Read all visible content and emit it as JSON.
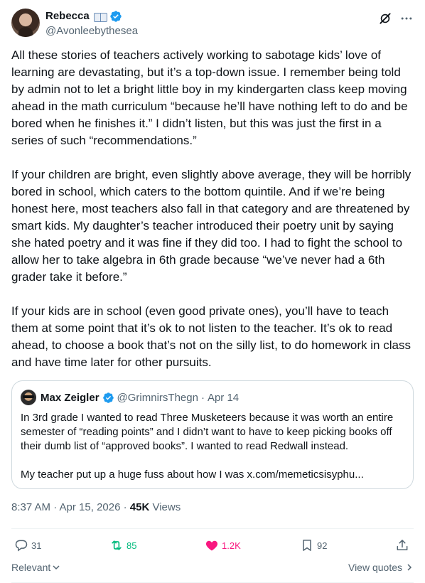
{
  "author": {
    "display_name": "Rebecca",
    "emoji_icon": "open-book-icon",
    "handle": "@Avonleebythesea"
  },
  "tweet": {
    "paragraphs": [
      "All these stories of teachers actively working to sabotage kids’ love of learning are devastating, but it’s a top-down issue. I remember being told by admin not to let a bright little boy in my kindergarten class keep moving ahead in the math curriculum “because he’ll have nothing left to do and be bored when he finishes it.” I didn’t listen, but this was just the first in a series of such “recommendations.”",
      "If your children are bright, even slightly above average, they will be horribly bored in school, which caters to the bottom quintile. And if we’re being honest here, most teachers also fall in that category and are threatened by smart kids. My daughter’s teacher introduced their poetry unit by saying she hated poetry and it was fine if they did too. I had to fight the school to allow her to take algebra in 6th grade because “we’ve never had a 6th grader take it before.”",
      "If your kids are in school (even good private ones), you’ll have to teach them at some point that it’s ok to not listen to the teacher. It’s ok to read ahead, to choose a book that’s not on the silly list, to do homework in class and have time later for other pursuits."
    ]
  },
  "quote": {
    "display_name": "Max Zeigler",
    "handle": "@GrimnirsThegn",
    "separator": "·",
    "date": "Apr 14",
    "paragraphs": [
      "In 3rd grade I wanted to read Three Musketeers because it was worth an entire semester of “reading points” and I didn’t want to have to keep picking books off their dumb list of “approved books”. I wanted to read Redwall instead.",
      "My teacher put up a huge fuss about how I was x.com/memeticsisyphu..."
    ]
  },
  "meta": {
    "timestamp": "8:37 AM · Apr 15, 2026 · ",
    "views_count": "45K",
    "views_label": " Views"
  },
  "actions": {
    "replies": "31",
    "reposts": "85",
    "likes": "1.2K",
    "bookmarks": "92"
  },
  "footer": {
    "sort_label": "Relevant",
    "view_quotes_label": "View quotes"
  },
  "colors": {
    "verified": "#1d9bf0",
    "repost_active": "#00ba7c",
    "like_active": "#f91880",
    "secondary_text": "#536471"
  }
}
